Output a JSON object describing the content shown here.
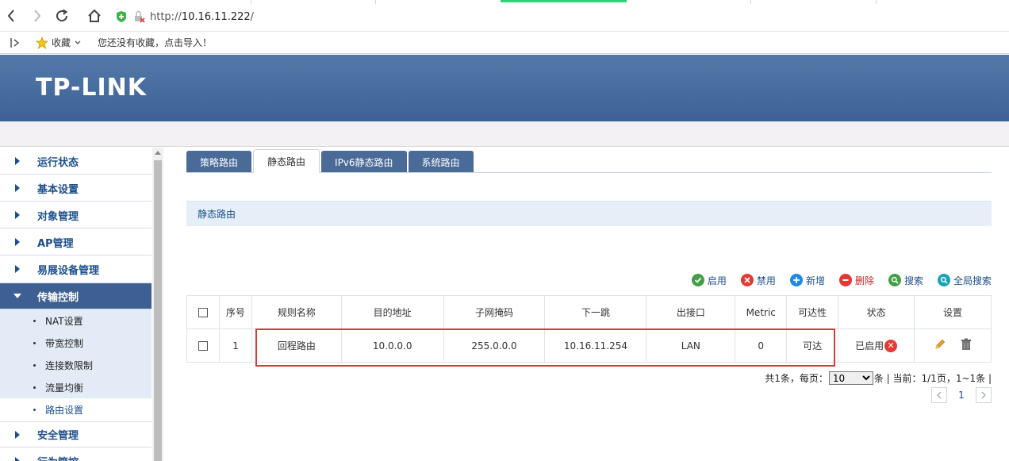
{
  "browser": {
    "url_scheme": "http://",
    "url_host": "10.16.11.222",
    "url_path": "/",
    "bookmarks_label": "收藏",
    "bookmarks_hint": "您还没有收藏，点击导入！"
  },
  "header": {
    "brand": "TP-LINK"
  },
  "sidebar": {
    "items": [
      {
        "label": "运行状态"
      },
      {
        "label": "基本设置"
      },
      {
        "label": "对象管理"
      },
      {
        "label": "AP管理"
      },
      {
        "label": "易展设备管理"
      },
      {
        "label": "传输控制"
      },
      {
        "label": "安全管理"
      },
      {
        "label": "行为管控"
      }
    ],
    "sub_items": [
      {
        "label": "NAT设置"
      },
      {
        "label": "带宽控制"
      },
      {
        "label": "连接数限制"
      },
      {
        "label": "流量均衡"
      },
      {
        "label": "路由设置"
      }
    ]
  },
  "tabs": [
    {
      "label": "策略路由"
    },
    {
      "label": "静态路由"
    },
    {
      "label": "IPv6静态路由"
    },
    {
      "label": "系统路由"
    }
  ],
  "section_title": "静态路由",
  "toolbar": {
    "enable": "启用",
    "disable": "禁用",
    "add": "新增",
    "delete": "删除",
    "search": "搜索",
    "global_search": "全局搜索"
  },
  "table": {
    "headers": {
      "index": "序号",
      "rule_name": "规则名称",
      "destination": "目的地址",
      "mask": "子网掩码",
      "next_hop": "下一跳",
      "interface": "出接口",
      "metric": "Metric",
      "reachable": "可达性",
      "status": "状态",
      "settings": "设置"
    },
    "rows": [
      {
        "index": "1",
        "rule_name": "回程路由",
        "destination": "10.0.0.0",
        "mask": "255.0.0.0",
        "next_hop": "10.16.11.254",
        "interface": "LAN",
        "metric": "0",
        "reachable": "可达",
        "status": "已启用"
      }
    ]
  },
  "pager": {
    "total_text": "共1条，每页：",
    "page_size": "10",
    "page_size_options": [
      "10"
    ],
    "after_text": "条 | 当前：1/1页，1~1条 |",
    "current_page": "1"
  },
  "colors": {
    "header_blue": "#3c6196",
    "nav_text": "#1d4f8c",
    "highlight_red": "#d83a3a"
  }
}
